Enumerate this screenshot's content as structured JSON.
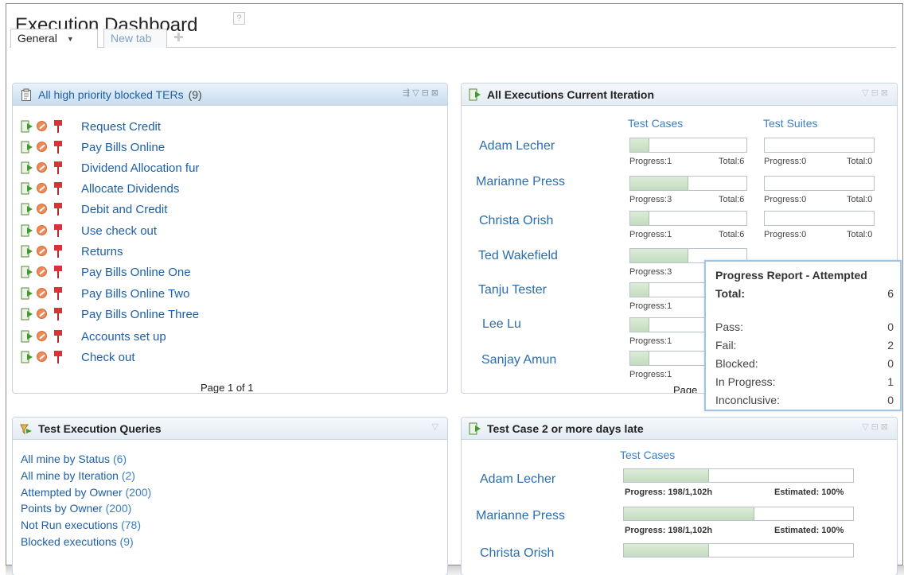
{
  "page": {
    "title": "Execution Dashboard",
    "help_glyph": "?"
  },
  "tabs": {
    "general": "General",
    "new_tab": "New tab",
    "add_glyph": "✚"
  },
  "blocked_panel": {
    "title": "All high priority blocked TERs",
    "count": "(9)",
    "items": [
      "Request Credit",
      "Pay Bills Online",
      "Dividend Allocation fur",
      "Allocate Dividends",
      "Debit and Credit",
      "Use check out",
      "Returns",
      "Pay Bills Online One",
      "Pay Bills Online Two",
      "Pay Bills Online Three",
      "Accounts set up",
      "Check out"
    ],
    "footer": "Page 1 of 1",
    "icons": [
      "run-test-icon",
      "blocked-icon",
      "priority-flag-icon"
    ]
  },
  "exec_panel": {
    "title": "All Executions Current Iteration",
    "col_test_cases": "Test Cases",
    "col_test_suites": "Test Suites",
    "rows": [
      {
        "name": "Adam Lecher",
        "tc_progress_label": "Progress:1",
        "tc_total_label": "Total:6",
        "tc_fraction": 0.167,
        "ts_progress_label": "Progress:0",
        "ts_total_label": "Total:0"
      },
      {
        "name": "Marianne Press",
        "tc_progress_label": "Progress:3",
        "tc_total_label": "Total:6",
        "tc_fraction": 0.5,
        "ts_progress_label": "Progress:0",
        "ts_total_label": "Total:0"
      },
      {
        "name": "Christa Orish",
        "tc_progress_label": "Progress:1",
        "tc_total_label": "Total:6",
        "tc_fraction": 0.167,
        "ts_progress_label": "Progress:0",
        "ts_total_label": "Total:0"
      },
      {
        "name": "Ted Wakefield",
        "tc_progress_label": "Progress:3",
        "tc_fraction": 0.5
      },
      {
        "name": "Tanju Tester",
        "tc_progress_label": "Progress:1",
        "tc_fraction": 0.167
      },
      {
        "name": "Lee Lu",
        "tc_progress_label": "Progress:1",
        "tc_fraction": 0.167
      },
      {
        "name": "Sanjay Amun",
        "tc_progress_label": "Progress:1",
        "tc_fraction": 0.167
      }
    ],
    "footer": "Page"
  },
  "tooltip": {
    "title": "Progress Report - Attempted",
    "total_label": "Total:",
    "total_value": "6",
    "rows": [
      {
        "label": "Pass:",
        "value": "0"
      },
      {
        "label": "Fail:",
        "value": "2"
      },
      {
        "label": "Blocked:",
        "value": "0"
      },
      {
        "label": "In Progress:",
        "value": "1"
      },
      {
        "label": "Inconclusive:",
        "value": "0"
      }
    ]
  },
  "queries_panel": {
    "title": "Test Execution Queries",
    "items": [
      {
        "label": "All mine by Status",
        "count": "(6)"
      },
      {
        "label": "All mine by Iteration",
        "count": "(2)"
      },
      {
        "label": "Attempted by Owner",
        "count": "(200)"
      },
      {
        "label": "Points by Owner",
        "count": "(200)"
      },
      {
        "label": "Not Run executions",
        "count": "(78)"
      },
      {
        "label": "Blocked executions",
        "count": "(9)"
      }
    ]
  },
  "late_panel": {
    "title": "Test Case 2 or more days late",
    "col_test_cases": "Test Cases",
    "rows": [
      {
        "name": "Adam Lecher",
        "progress_label": "Progress: 198/1,102h",
        "estimated_label": "Estimated: 100%",
        "fraction": 0.37
      },
      {
        "name": "Marianne Press",
        "progress_label": "Progress: 198/1,102h",
        "estimated_label": "Estimated: 100%",
        "fraction": 0.57
      },
      {
        "name": "Christa Orish",
        "fraction": 0.37
      }
    ]
  },
  "colors": {
    "link": "#1d5fa6",
    "accent_blue": "#3a7fc7",
    "bar_fill": "#c4dcc0",
    "blocked_orange": "#ee8a58",
    "flag_red": "#d9333a"
  }
}
